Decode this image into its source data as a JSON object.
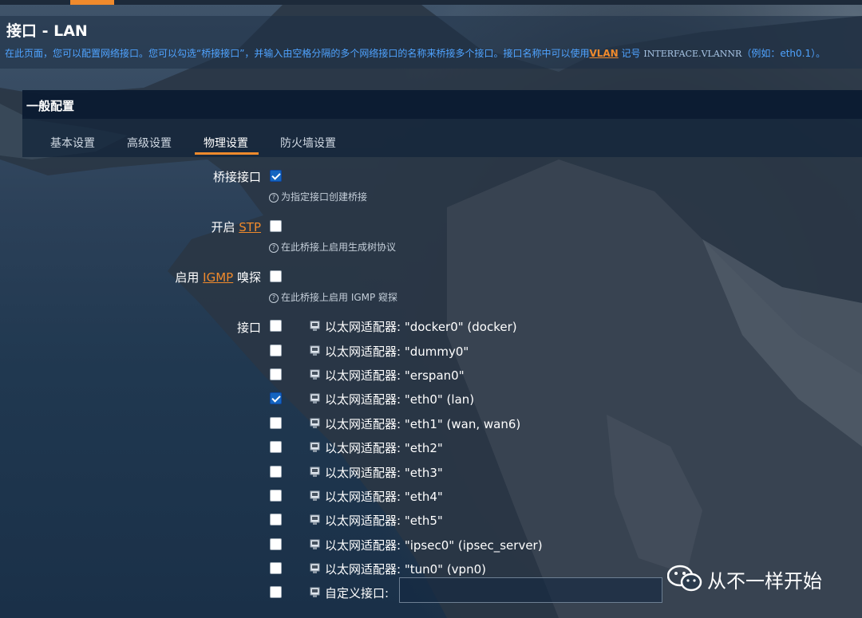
{
  "header": {
    "title": "接口 - LAN",
    "description_prefix": "在此页面，您可以配置网络接口。您可以勾选“桥接接口”，并输入由空格分隔的多个网络接口的名称来桥接多个接口。接口名称中可以使用",
    "description_link": "VLAN",
    "description_mid": "记号",
    "description_mono": "INTERFACE.VLANNR",
    "description_suffix": "（例如：eth0.1）。"
  },
  "section": {
    "title": "一般配置",
    "tabs": [
      {
        "label": "基本设置",
        "active": false
      },
      {
        "label": "高级设置",
        "active": false
      },
      {
        "label": "物理设置",
        "active": true
      },
      {
        "label": "防火墙设置",
        "active": false
      }
    ]
  },
  "fields": {
    "bridge": {
      "label": "桥接接口",
      "checked": true,
      "hint": "为指定接口创建桥接"
    },
    "stp": {
      "label_prefix": "开启",
      "label_link": "STP",
      "checked": false,
      "hint": "在此桥接上启用生成树协议"
    },
    "igmp": {
      "label_prefix": "启用",
      "label_link": "IGMP",
      "label_suffix": "嗅探",
      "checked": false,
      "hint": "在此桥接上启用 IGMP 窥探"
    },
    "interfaces_label": "接口"
  },
  "interfaces": [
    {
      "text": "以太网适配器: \"docker0\" (docker)",
      "checked": false
    },
    {
      "text": "以太网适配器: \"dummy0\"",
      "checked": false
    },
    {
      "text": "以太网适配器: \"erspan0\"",
      "checked": false
    },
    {
      "text": "以太网适配器: \"eth0\" (lan)",
      "checked": true
    },
    {
      "text": "以太网适配器: \"eth1\" (wan, wan6)",
      "checked": false
    },
    {
      "text": "以太网适配器: \"eth2\"",
      "checked": false
    },
    {
      "text": "以太网适配器: \"eth3\"",
      "checked": false
    },
    {
      "text": "以太网适配器: \"eth4\"",
      "checked": false
    },
    {
      "text": "以太网适配器: \"eth5\"",
      "checked": false
    },
    {
      "text": "以太网适配器: \"ipsec0\" (ipsec_server)",
      "checked": false
    },
    {
      "text": "以太网适配器: \"tun0\" (vpn0)",
      "checked": false
    }
  ],
  "custom_interface": {
    "label": "自定义接口:",
    "value": "",
    "checked": false
  },
  "watermark": {
    "text": "从不一样开始"
  },
  "colors": {
    "accent": "#f08a2c",
    "link_blue": "#4fa3ff",
    "checkbox_checked": "#1565c0"
  },
  "icons": {
    "interface": "ethernet-port-icon",
    "hint": "question-circle-icon",
    "watermark": "wechat-icon"
  }
}
